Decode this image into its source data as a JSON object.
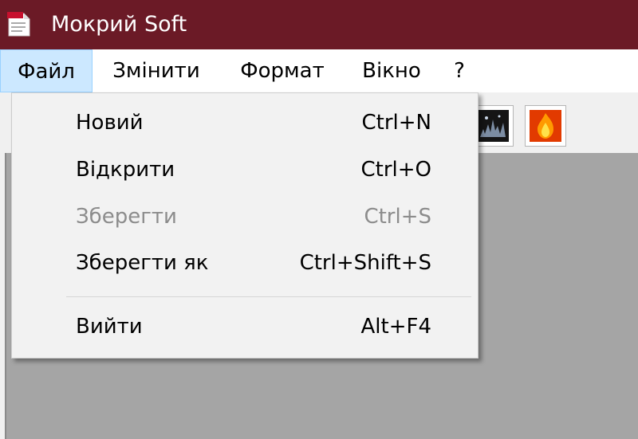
{
  "window": {
    "title": "Мокрий Soft",
    "titlebar_color": "#6b1a26",
    "app_icon": "app-document-icon"
  },
  "menubar": {
    "items": [
      {
        "label": "Файл",
        "active": true
      },
      {
        "label": "Змінити",
        "active": false
      },
      {
        "label": "Формат",
        "active": false
      },
      {
        "label": "Вікно",
        "active": false
      },
      {
        "label": "?",
        "active": false
      }
    ]
  },
  "toolbar": {
    "buttons": [
      {
        "icon": "dark-image-icon"
      },
      {
        "icon": "fire-image-icon"
      }
    ]
  },
  "file_menu": {
    "items": [
      {
        "label": "Новий",
        "shortcut": "Ctrl+N",
        "enabled": true
      },
      {
        "label": "Відкрити",
        "shortcut": "Ctrl+O",
        "enabled": true
      },
      {
        "label": "Зберегти",
        "shortcut": "Ctrl+S",
        "enabled": false
      },
      {
        "label": "Зберегти як",
        "shortcut": "Ctrl+Shift+S",
        "enabled": true
      },
      {
        "label": "Вийти",
        "shortcut": "Alt+F4",
        "enabled": true
      }
    ]
  }
}
